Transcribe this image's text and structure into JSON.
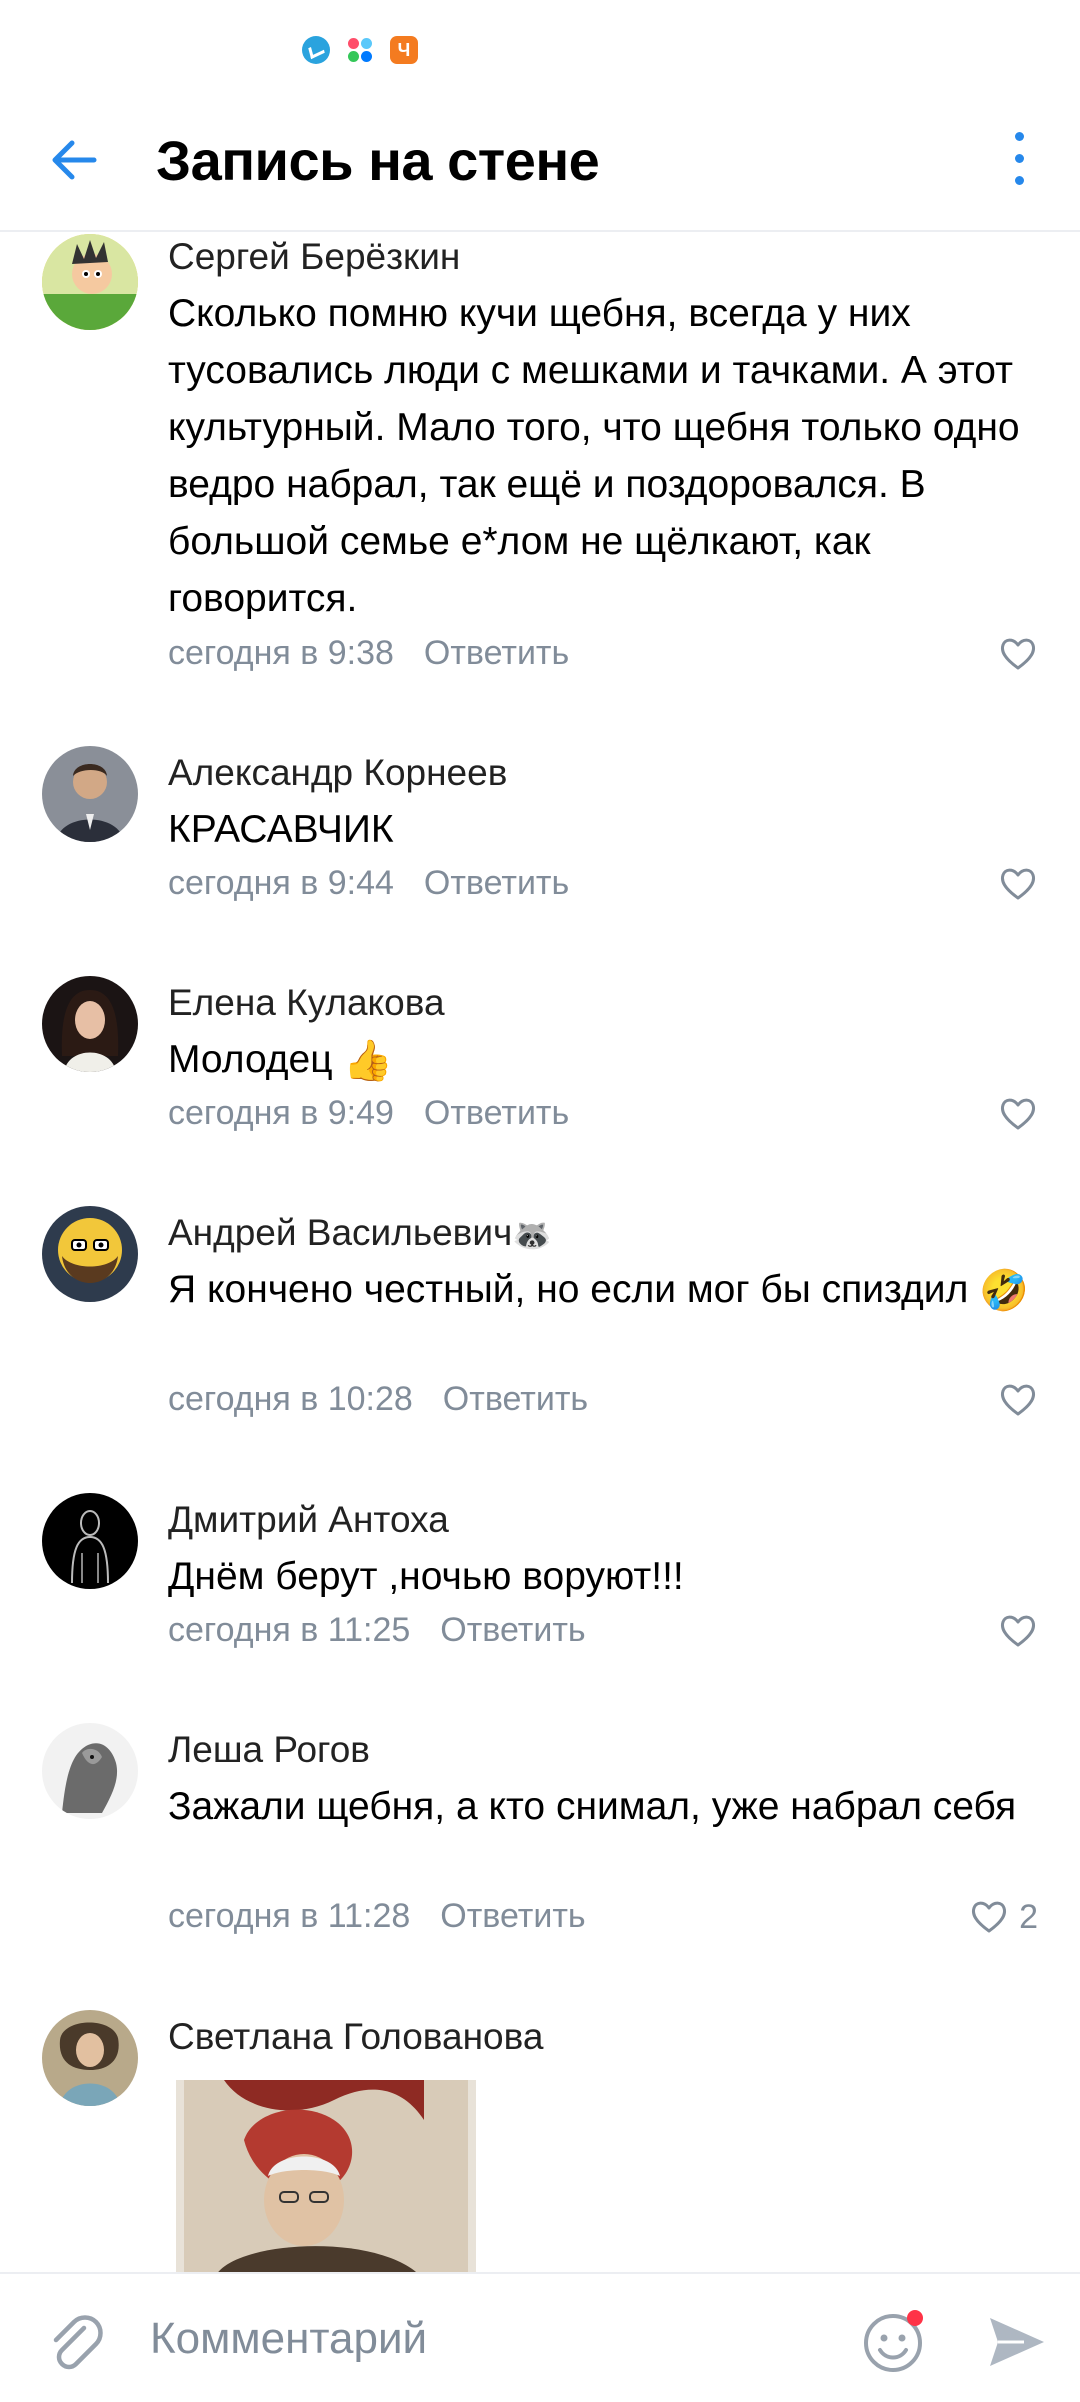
{
  "header": {
    "title": "Запись на стене"
  },
  "comments": [
    {
      "author": "Сергей Берёзкин",
      "text": "Сколько помню кучи щебня, всегда у них тусовались люди с мешками и тачками. А этот культурный. Мало того, что щебня только одно ведро набрал, так ещё и поздоровался. В большой семье е*лом не щёлкают, как говорится.",
      "time": "сегодня в 9:38",
      "reply": "Ответить",
      "likes": ""
    },
    {
      "author": "Александр Корнеев",
      "text": "КРАСАВЧИК",
      "time": "сегодня в 9:44",
      "reply": "Ответить",
      "likes": ""
    },
    {
      "author": "Елена Кулакова",
      "text": "Молодец",
      "emoji": "👍",
      "time": "сегодня в 9:49",
      "reply": "Ответить",
      "likes": ""
    },
    {
      "author": "Андрей Васильевич",
      "author_emoji": "🦝",
      "text": "Я кончено честный, но если мог бы спиздил",
      "emoji": "🤣",
      "time": "сегодня в 10:28",
      "reply": "Ответить",
      "likes": ""
    },
    {
      "author": "Дмитрий Антоха",
      "text": "Днём берут ,ночью воруют!!!",
      "time": "сегодня в 11:25",
      "reply": "Ответить",
      "likes": ""
    },
    {
      "author": "Леша Рогов",
      "text": "Зажали щебня, а кто снимал, уже набрал себя",
      "time": "сегодня в 11:28",
      "reply": "Ответить",
      "likes": "2"
    },
    {
      "author": "Светлана Голованова"
    }
  ],
  "input": {
    "placeholder": "Комментарий"
  },
  "colors": {
    "accent": "#2688eb",
    "secondary_text": "#818c99",
    "divider": "#eceef2"
  }
}
